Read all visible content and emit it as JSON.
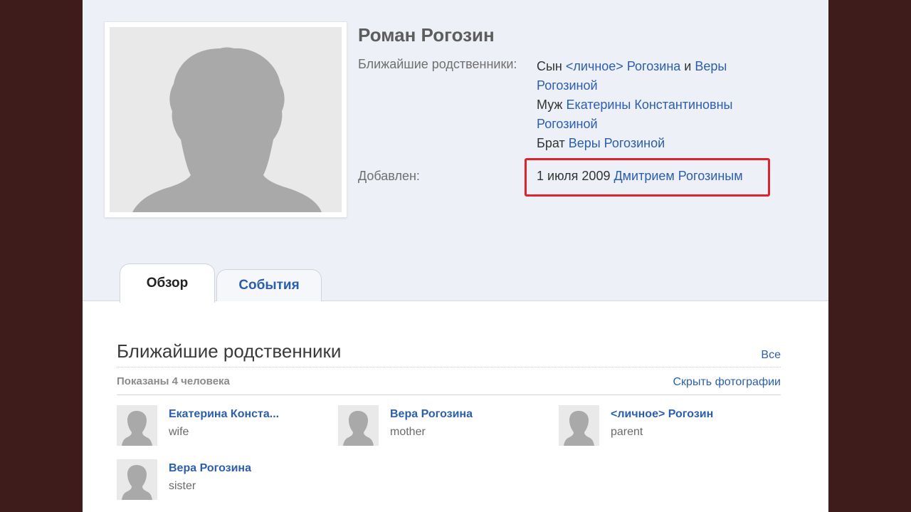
{
  "profile": {
    "name": "Роман Рогозин",
    "relatives_label": "Ближайшие родственники:",
    "relatives_lines": [
      {
        "prefix": "Сын ",
        "link1": "<личное> Рогозина",
        "mid": " и ",
        "link2": "Веры Рогозиной"
      },
      {
        "prefix": "Муж ",
        "link1": "Екатерины Константиновны Рогозиной"
      },
      {
        "prefix": "Брат ",
        "link1": "Веры Рогозиной"
      }
    ],
    "added_label": "Добавлен:",
    "added_date": "1 июля 2009",
    "added_by": "Дмитрием Рогозиным"
  },
  "tabs": [
    {
      "label": "Обзор",
      "active": true
    },
    {
      "label": "События",
      "active": false
    }
  ],
  "relatives_section": {
    "title": "Ближайшие родственники",
    "all_link": "Все",
    "shown_count": "Показаны 4 человека",
    "hide_photos": "Скрыть фотографии",
    "people": [
      {
        "name": "Екатерина Конста...",
        "role": "wife"
      },
      {
        "name": "Вера Рогозина",
        "role": "mother"
      },
      {
        "name": "<личное> Рогозин",
        "role": "parent"
      },
      {
        "name": "Вера Рогозина",
        "role": "sister"
      }
    ]
  },
  "colors": {
    "background": "#3e1c1c",
    "header_bg": "#eef0f7",
    "link": "#2b5ead",
    "highlight_box": "#e0222a",
    "silhouette": "#a9a9a9"
  }
}
